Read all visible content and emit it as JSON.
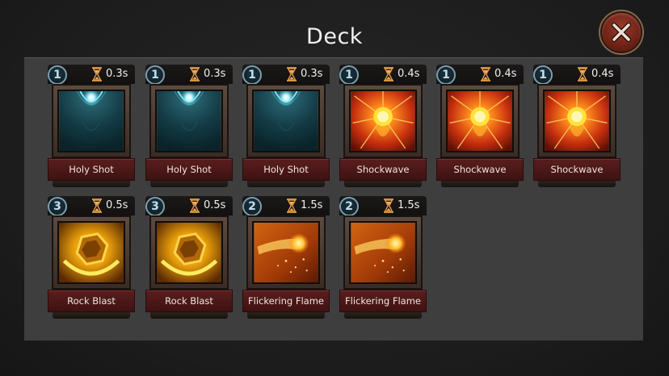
{
  "title": "Deck",
  "close_icon": "close-x-icon",
  "colors": {
    "panel": "#3e3e3e",
    "name_plate": "#5a1e1e",
    "close_button": "#6e2216"
  },
  "cards": [
    {
      "count": "1",
      "cooldown": "0.3s",
      "name": "Holy Shot",
      "art": "holy-shot"
    },
    {
      "count": "1",
      "cooldown": "0.3s",
      "name": "Holy Shot",
      "art": "holy-shot"
    },
    {
      "count": "1",
      "cooldown": "0.3s",
      "name": "Holy Shot",
      "art": "holy-shot"
    },
    {
      "count": "1",
      "cooldown": "0.4s",
      "name": "Shockwave",
      "art": "shockwave"
    },
    {
      "count": "1",
      "cooldown": "0.4s",
      "name": "Shockwave",
      "art": "shockwave"
    },
    {
      "count": "1",
      "cooldown": "0.4s",
      "name": "Shockwave",
      "art": "shockwave"
    },
    {
      "count": "3",
      "cooldown": "0.5s",
      "name": "Rock Blast",
      "art": "rock-blast"
    },
    {
      "count": "3",
      "cooldown": "0.5s",
      "name": "Rock Blast",
      "art": "rock-blast"
    },
    {
      "count": "2",
      "cooldown": "1.5s",
      "name": "Flickering Flame",
      "art": "flickering-flame"
    },
    {
      "count": "2",
      "cooldown": "1.5s",
      "name": "Flickering Flame",
      "art": "flickering-flame"
    }
  ]
}
